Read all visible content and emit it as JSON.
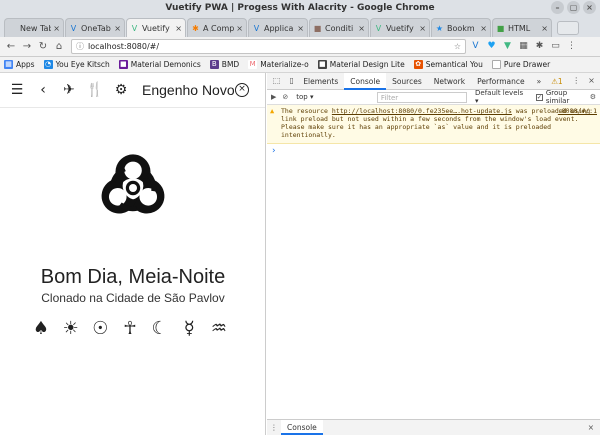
{
  "window": {
    "title": "Vuetify PWA | Progess With Alacrity - Google Chrome",
    "controls": [
      "–",
      "▢",
      "×"
    ]
  },
  "tabs": [
    {
      "label": "New Tab",
      "icon": "",
      "active": false
    },
    {
      "label": "OneTab",
      "icon": "V",
      "active": false
    },
    {
      "label": "Vuetify P",
      "icon": "V",
      "active": true
    },
    {
      "label": "A Comp",
      "icon": "✱",
      "active": false
    },
    {
      "label": "Applica",
      "icon": "V",
      "active": false
    },
    {
      "label": "Conditi",
      "icon": "■",
      "active": false
    },
    {
      "label": "Vuetify P",
      "icon": "V",
      "active": false
    },
    {
      "label": "Bookm",
      "icon": "★",
      "active": false
    },
    {
      "label": "HTML",
      "icon": "■",
      "active": false
    }
  ],
  "toolbar": {
    "url": "localhost:8080/#/"
  },
  "bookmarks": [
    {
      "label": "Apps",
      "color": "#4285f4"
    },
    {
      "label": "You Eye Kitsch",
      "color": "#1e88e5"
    },
    {
      "label": "Material Demonics",
      "color": "#6a1b9a"
    },
    {
      "label": "BMD",
      "color": "#5c3c8c"
    },
    {
      "label": "Materialize-o",
      "color": "#ee6e73"
    },
    {
      "label": "Material Design Lite",
      "color": "#444444"
    },
    {
      "label": "Semantical You",
      "color": "#e65100"
    },
    {
      "label": "Pure Drawer",
      "color": "#888888"
    }
  ],
  "app": {
    "title": "Engenho Novo...",
    "greeting": "Bom Dia, Meia-Noite",
    "subtitle": "Clonado na Cidade de São Pavlov",
    "hero_icon": "biohazard-icon",
    "symbols": [
      "♠",
      "☀",
      "☉",
      "☥",
      "☾",
      "☿",
      "♒"
    ]
  },
  "devtools": {
    "tabs": [
      "Elements",
      "Console",
      "Sources",
      "Network",
      "Performance"
    ],
    "active_tab": "Console",
    "more": "»",
    "warn_count": "1",
    "context": "top",
    "filter_placeholder": "Filter",
    "levels": "Default levels ▾",
    "group_similar": "Group similar",
    "warning": {
      "prefix": "The resource ",
      "link": "http://localhost:8080/0.fe235ee….hot-update.js",
      "body": " was preloaded using link preload but not used within a few seconds from the window's load event. Please make sure it has an appropriate `as` value and it is preloaded intentionally.",
      "source": ":8080/#/:1"
    },
    "prompt": "›",
    "drawer_tab": "Console"
  }
}
